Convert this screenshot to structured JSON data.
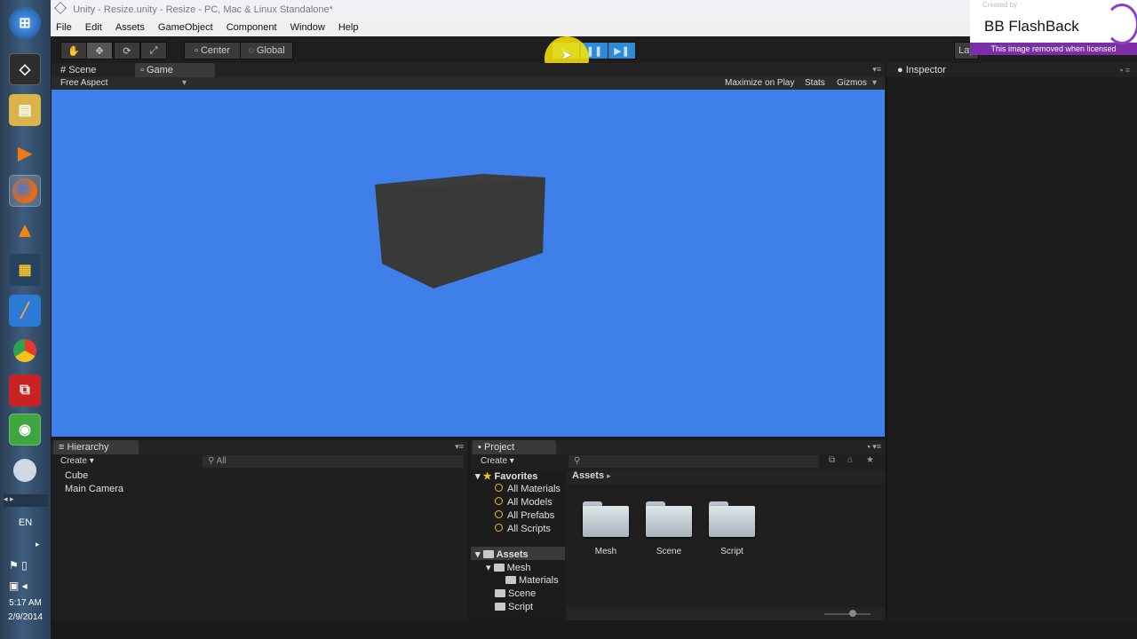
{
  "window": {
    "title": "Unity - Resize.unity - Resize - PC, Mac & Linux Standalone*"
  },
  "menu": [
    "File",
    "Edit",
    "Assets",
    "GameObject",
    "Component",
    "Window",
    "Help"
  ],
  "toolbar": {
    "center_label": "Center",
    "global_label": "Global",
    "layout_label": "Lay"
  },
  "tabs": {
    "scene": "Scene",
    "game": "Game",
    "inspector": "Inspector",
    "hierarchy": "Hierarchy",
    "project": "Project"
  },
  "game_bar": {
    "aspect": "Free Aspect",
    "maximize": "Maximize on Play",
    "stats": "Stats",
    "gizmos": "Gizmos"
  },
  "hierarchy": {
    "create": "Create",
    "search_placeholder": "All",
    "items": [
      "Cube",
      "Main Camera"
    ]
  },
  "project": {
    "create": "Create",
    "favorites_label": "Favorites",
    "favorites": [
      "All Materials",
      "All Models",
      "All Prefabs",
      "All Scripts"
    ],
    "assets_label": "Assets",
    "assets_tree": [
      "Mesh",
      "Materials",
      "Scene",
      "Script"
    ],
    "breadcrumb": "Assets",
    "folders": [
      "Mesh",
      "Scene",
      "Script"
    ]
  },
  "taskbar": {
    "lang": "EN",
    "time": "5:17 AM",
    "date": "2/9/2014"
  },
  "watermark": {
    "title": "BB FlashBack",
    "note": "This image removed when licensed",
    "created": "Created by"
  },
  "colors": {
    "game_bg": "#3f7fe9",
    "cube": "#393939",
    "play_active": "#2b8bd6",
    "dark_panel": "#1f1f1f"
  }
}
